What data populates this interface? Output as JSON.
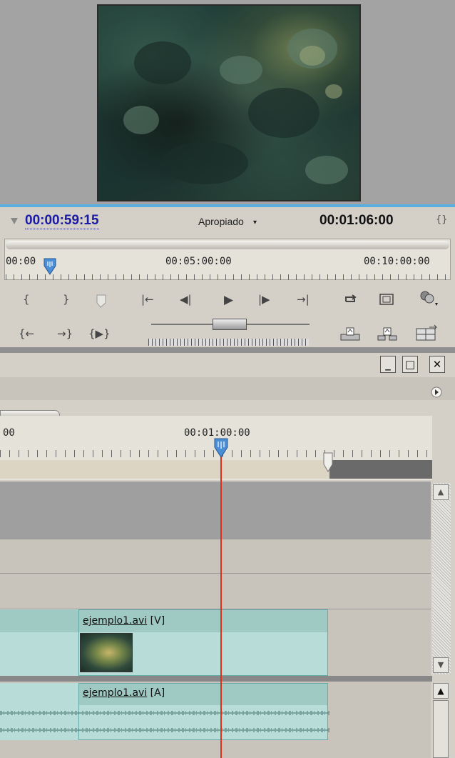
{
  "monitor": {
    "current_timecode": "00:00:59:15",
    "zoom_label": "Apropiado",
    "zoom_arrow": "▾",
    "duration_timecode": "00:01:06:00",
    "duration_icon": "{}",
    "ruler_labels": [
      "00:00",
      "00:05:00:00",
      "00:10:00:00"
    ]
  },
  "controls": {
    "mark_in": "{",
    "mark_out": "}",
    "set_marker": "marker-icon",
    "go_to_in": "{←",
    "go_to_out": "→}",
    "play_in_to_out": "{▶}",
    "go_prev_edit": "|←",
    "step_back": "◀|",
    "play": "▶",
    "step_forward": "|▶",
    "go_next_edit": "→|",
    "loop": "loop-icon",
    "safe_margins": "safe-margins-icon",
    "output": "output-icon",
    "lift": "lift-icon",
    "extract": "extract-icon",
    "trim": "trim-icon"
  },
  "window": {
    "minimize": "_",
    "maximize": "□",
    "close": "✕"
  },
  "timeline": {
    "ruler_labels": [
      "00",
      "00:01:00:00"
    ],
    "video_clip_name": "ejemplo1.avi",
    "video_clip_suffix": "[V]",
    "audio_clip_name": "ejemplo1.avi",
    "audio_clip_suffix": "[A]"
  },
  "colors": {
    "timecode_blue": "#1a1aa6",
    "playhead_red": "#e0301a",
    "clip_teal": "#b8dcd8",
    "accent_blue": "#5aaee0"
  }
}
